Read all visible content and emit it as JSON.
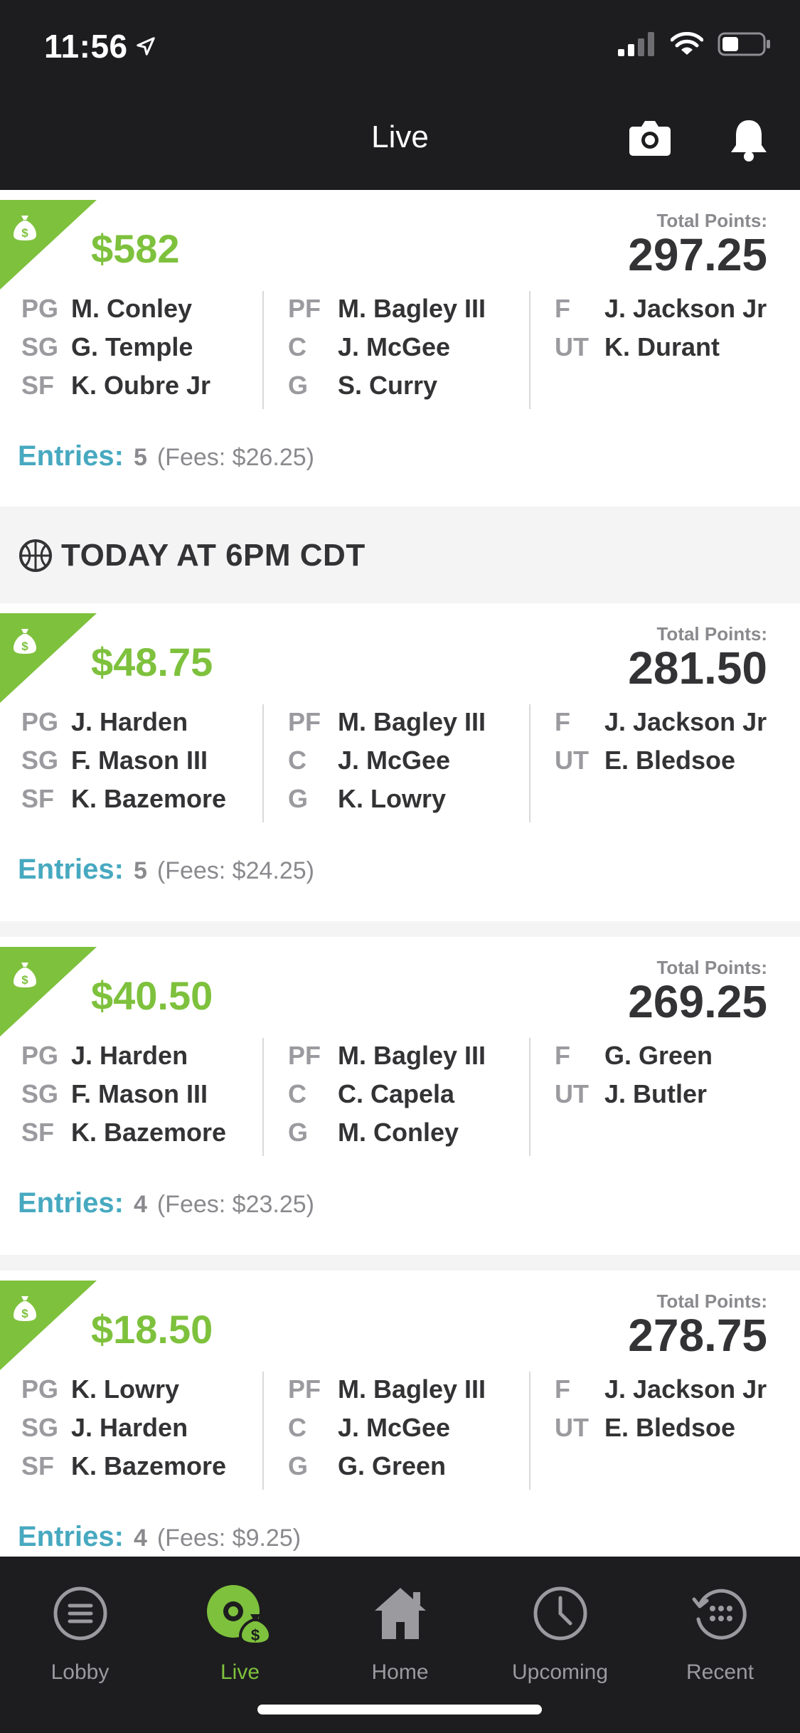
{
  "status_bar": {
    "time": "11:56"
  },
  "header": {
    "title": "Live"
  },
  "cards": [
    {
      "prize": "$582",
      "total_label": "Total Points:",
      "total_points": "297.25",
      "roster": [
        [
          {
            "pos": "PG",
            "name": "M. Conley"
          },
          {
            "pos": "SG",
            "name": "G. Temple"
          },
          {
            "pos": "SF",
            "name": "K. Oubre Jr"
          }
        ],
        [
          {
            "pos": "PF",
            "name": "M. Bagley III"
          },
          {
            "pos": "C",
            "name": "J. McGee"
          },
          {
            "pos": "G",
            "name": "S. Curry"
          }
        ],
        [
          {
            "pos": "F",
            "name": "J. Jackson Jr"
          },
          {
            "pos": "UT",
            "name": "K. Durant"
          }
        ]
      ],
      "entries_label": "Entries:",
      "entries_count": "5",
      "fees": "(Fees: $26.25)"
    },
    {
      "prize": "$48.75",
      "total_label": "Total Points:",
      "total_points": "281.50",
      "roster": [
        [
          {
            "pos": "PG",
            "name": "J. Harden"
          },
          {
            "pos": "SG",
            "name": "F. Mason III"
          },
          {
            "pos": "SF",
            "name": "K. Bazemore"
          }
        ],
        [
          {
            "pos": "PF",
            "name": "M. Bagley III"
          },
          {
            "pos": "C",
            "name": "J. McGee"
          },
          {
            "pos": "G",
            "name": "K. Lowry"
          }
        ],
        [
          {
            "pos": "F",
            "name": "J. Jackson Jr"
          },
          {
            "pos": "UT",
            "name": "E. Bledsoe"
          }
        ]
      ],
      "entries_label": "Entries:",
      "entries_count": "5",
      "fees": "(Fees: $24.25)"
    },
    {
      "prize": "$40.50",
      "total_label": "Total Points:",
      "total_points": "269.25",
      "roster": [
        [
          {
            "pos": "PG",
            "name": "J. Harden"
          },
          {
            "pos": "SG",
            "name": "F. Mason III"
          },
          {
            "pos": "SF",
            "name": "K. Bazemore"
          }
        ],
        [
          {
            "pos": "PF",
            "name": "M. Bagley III"
          },
          {
            "pos": "C",
            "name": "C. Capela"
          },
          {
            "pos": "G",
            "name": "M. Conley"
          }
        ],
        [
          {
            "pos": "F",
            "name": "G. Green"
          },
          {
            "pos": "UT",
            "name": "J. Butler"
          }
        ]
      ],
      "entries_label": "Entries:",
      "entries_count": "4",
      "fees": "(Fees: $23.25)"
    },
    {
      "prize": "$18.50",
      "total_label": "Total Points:",
      "total_points": "278.75",
      "roster": [
        [
          {
            "pos": "PG",
            "name": "K. Lowry"
          },
          {
            "pos": "SG",
            "name": "J. Harden"
          },
          {
            "pos": "SF",
            "name": "K. Bazemore"
          }
        ],
        [
          {
            "pos": "PF",
            "name": "M. Bagley III"
          },
          {
            "pos": "C",
            "name": "J. McGee"
          },
          {
            "pos": "G",
            "name": "G. Green"
          }
        ],
        [
          {
            "pos": "F",
            "name": "J. Jackson Jr"
          },
          {
            "pos": "UT",
            "name": "E. Bledsoe"
          }
        ]
      ],
      "entries_label": "Entries:",
      "entries_count": "4",
      "fees": "(Fees: $9.25)"
    }
  ],
  "section": {
    "title": "TODAY AT 6PM CDT",
    "icon": "basketball-icon"
  },
  "bottom_nav": [
    {
      "label": "Lobby",
      "icon": "lobby-menu-icon"
    },
    {
      "label": "Live",
      "icon": "live-icon",
      "active": true
    },
    {
      "label": "Home",
      "icon": "home-icon"
    },
    {
      "label": "Upcoming",
      "icon": "clock-icon"
    },
    {
      "label": "Recent",
      "icon": "recent-history-icon"
    }
  ],
  "colors": {
    "accent_green": "#7ec13d",
    "entries_blue": "#47a9c0",
    "dark_bar": "#1d1d1f"
  }
}
